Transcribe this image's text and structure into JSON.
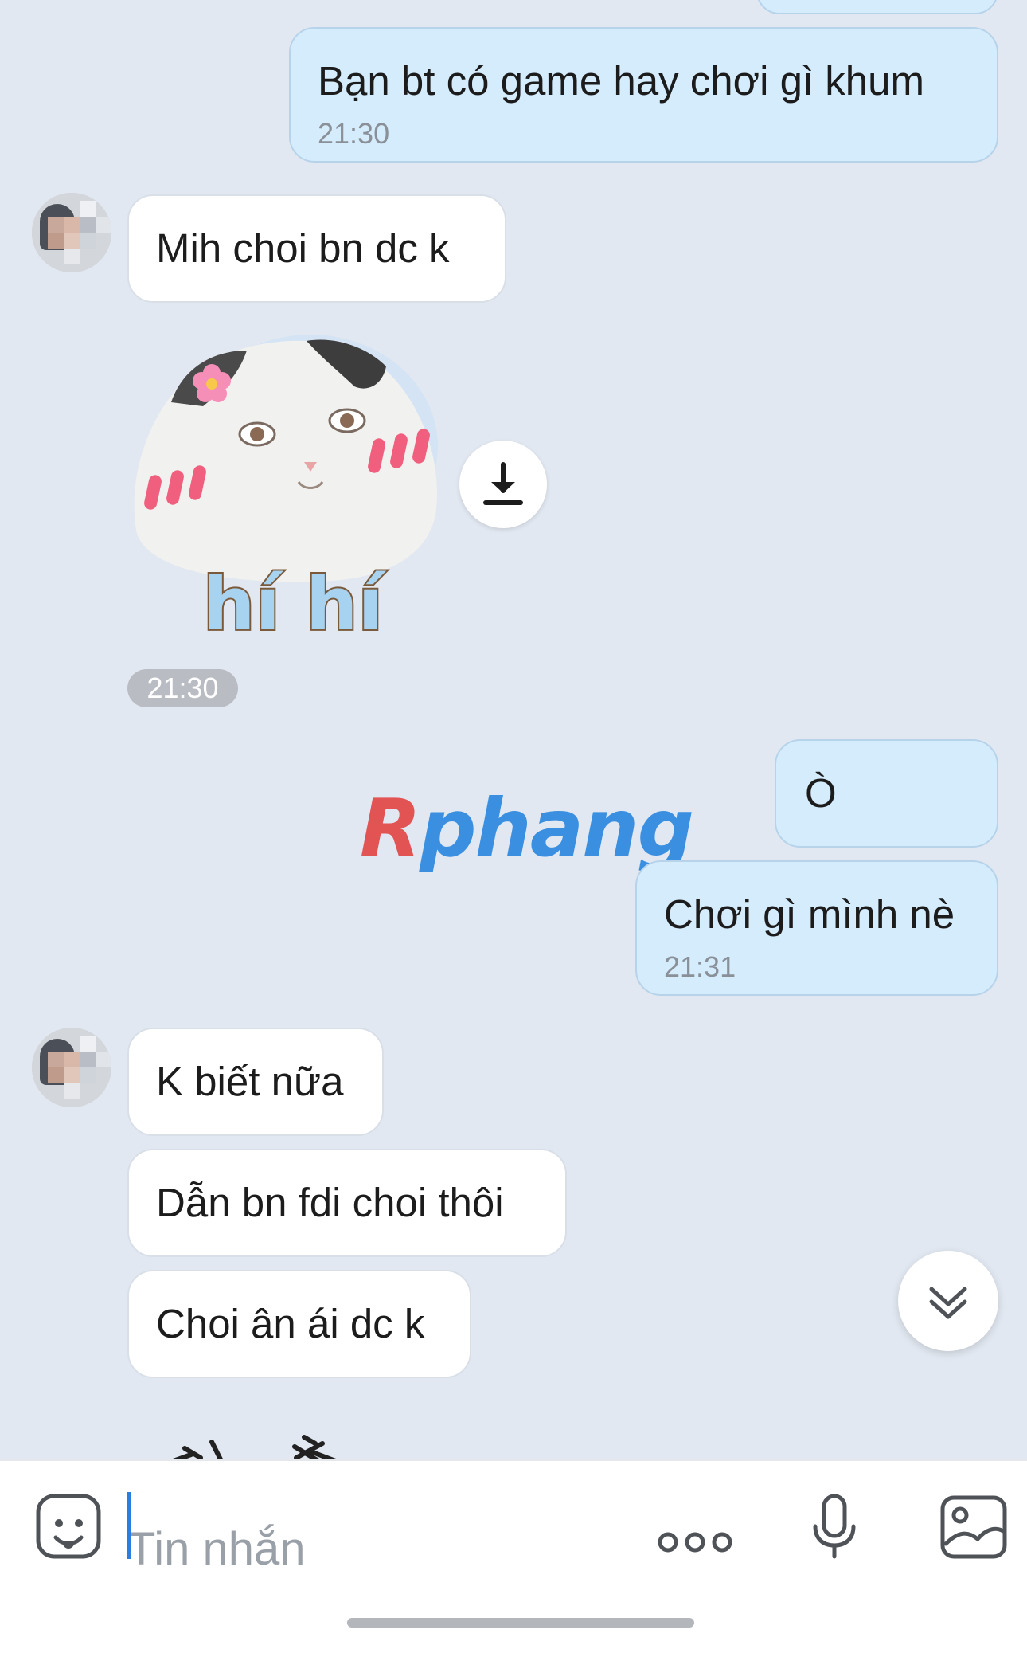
{
  "messages": {
    "m0": {
      "direction": "outgoing",
      "text": "Bạn bt có game hay chơi gì khum",
      "time": "21:30"
    },
    "m1": {
      "direction": "incoming",
      "text": "Mih choi bn dc k"
    },
    "m2": {
      "direction": "incoming",
      "type": "sticker",
      "sticker_caption": "hí hí",
      "time": "21:30"
    },
    "m3": {
      "direction": "outgoing",
      "text": "Ò"
    },
    "m4": {
      "direction": "outgoing",
      "text": "Chơi gì mình nè",
      "time": "21:31"
    },
    "m5": {
      "direction": "incoming",
      "text": "K biết nữa"
    },
    "m6": {
      "direction": "incoming",
      "text": "Dẫn bn fdi choi thôi"
    },
    "m7": {
      "direction": "incoming",
      "text": "Choi ân ái dc k"
    }
  },
  "watermark": {
    "first_letter": "R",
    "rest": "phang"
  },
  "composer": {
    "placeholder": "Tin nhắn",
    "icons": [
      "sticker-icon",
      "more-options-icon",
      "microphone-icon",
      "image-icon"
    ]
  },
  "controls": {
    "download_icon": "download-icon",
    "scroll_down_icon": "chevron-double-down-icon"
  },
  "colors": {
    "chat_background": "#e2e8f1",
    "outgoing_bubble": "#d5ecfd",
    "incoming_bubble": "#ffffff",
    "caret": "#2a7de1",
    "watermark_red": "#e25454",
    "watermark_blue": "#3b8fe0"
  }
}
